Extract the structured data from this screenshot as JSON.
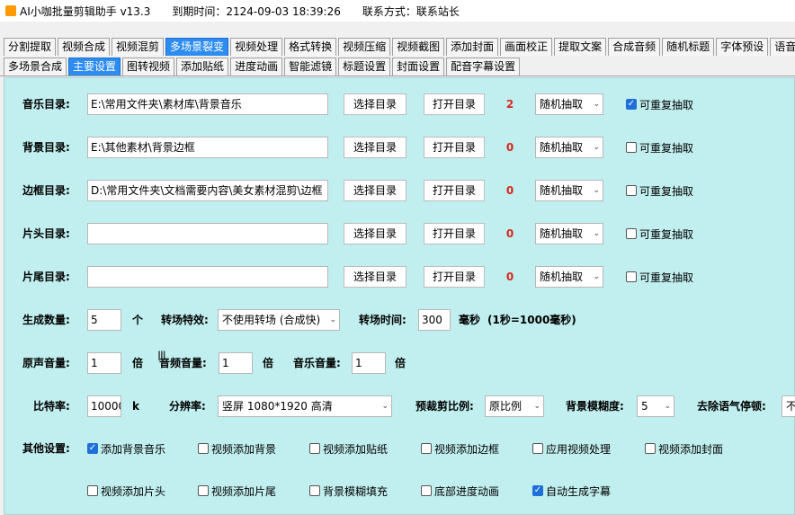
{
  "titlebar": {
    "app_name": "AI小咖批量剪辑助手 v13.3",
    "expire": "到期时间：2124-09-03 18:39:26",
    "contact": "联系方式：联系站长"
  },
  "tabs_row1": [
    "分割提取",
    "视频合成",
    "视频混剪",
    "多场景裂变",
    "视频处理",
    "格式转换",
    "视频压缩",
    "视频截图",
    "添加封面",
    "画面校正",
    "提取文案",
    "合成音频",
    "随机标题",
    "字体预设",
    "语音"
  ],
  "tabs_row1_active": 3,
  "tabs_row2": [
    "多场景合成",
    "主要设置",
    "图转视频",
    "添加贴纸",
    "进度动画",
    "智能滤镜",
    "标题设置",
    "封面设置",
    "配音字幕设置"
  ],
  "tabs_row2_active": 1,
  "buttons": {
    "choose_dir": "选择目录",
    "open_dir": "打开目录"
  },
  "dir_rows": [
    {
      "label": "音乐目录:",
      "path": "E:\\常用文件夹\\素材库\\背景音乐",
      "count": "2",
      "mode": "随机抽取",
      "repeat_label": "可重复抽取",
      "repeat_checked": true
    },
    {
      "label": "背景目录:",
      "path": "E:\\其他素材\\背景边框",
      "count": "0",
      "mode": "随机抽取",
      "repeat_label": "可重复抽取",
      "repeat_checked": false
    },
    {
      "label": "边框目录:",
      "path": "D:\\常用文件夹\\文档需要内容\\美女素材混剪\\边框",
      "count": "0",
      "mode": "随机抽取",
      "repeat_label": "可重复抽取",
      "repeat_checked": false
    },
    {
      "label": "片头目录:",
      "path": "",
      "count": "0",
      "mode": "随机抽取",
      "repeat_label": "可重复抽取",
      "repeat_checked": false
    },
    {
      "label": "片尾目录:",
      "path": "",
      "count": "0",
      "mode": "随机抽取",
      "repeat_label": "可重复抽取",
      "repeat_checked": false
    }
  ],
  "gen": {
    "count_label": "生成数量:",
    "count_value": "5",
    "count_unit": "个",
    "transition_label": "转场特效:",
    "transition_value": "不使用转场 (合成快)",
    "transition_time_label": "转场时间:",
    "transition_time_value": "300",
    "transition_time_unit": "毫秒",
    "transition_time_note": "(1秒=1000毫秒)"
  },
  "volume": {
    "orig_label": "原声音量:",
    "orig_value": "1",
    "orig_unit": "倍",
    "audio_label": "音频音量:",
    "audio_value": "1",
    "audio_unit": "倍",
    "music_label": "音乐音量:",
    "music_value": "1"
  },
  "video": {
    "bitrate_label": "比特率:",
    "bitrate_value": "10000",
    "bitrate_unit": "k",
    "resolution_label": "分辨率:",
    "resolution_value": "竖屏  1080*1920  高清",
    "crop_label": "预裁剪比例:",
    "crop_value": "原比例",
    "blur_label": "背景模糊度:",
    "blur_value": "5",
    "pause_label": "去除语气停顿:",
    "pause_value": "不"
  },
  "other": {
    "label": "其他设置:",
    "options": [
      {
        "label": "添加背景音乐",
        "checked": true
      },
      {
        "label": "视频添加背景",
        "checked": false
      },
      {
        "label": "视频添加贴纸",
        "checked": false
      },
      {
        "label": "视频添加边框",
        "checked": false
      },
      {
        "label": "应用视频处理",
        "checked": false
      },
      {
        "label": "视频添加封面",
        "checked": false
      },
      {
        "label": "视频添加片头",
        "checked": false
      },
      {
        "label": "视频添加片尾",
        "checked": false
      },
      {
        "label": "背景模糊填充",
        "checked": false
      },
      {
        "label": "底部进度动画",
        "checked": false
      },
      {
        "label": "自动生成字幕",
        "checked": true
      }
    ]
  },
  "colors": {
    "accent": "#2d8cf0",
    "panel_bg": "#c1eeee",
    "count_red": "#d9261c"
  }
}
